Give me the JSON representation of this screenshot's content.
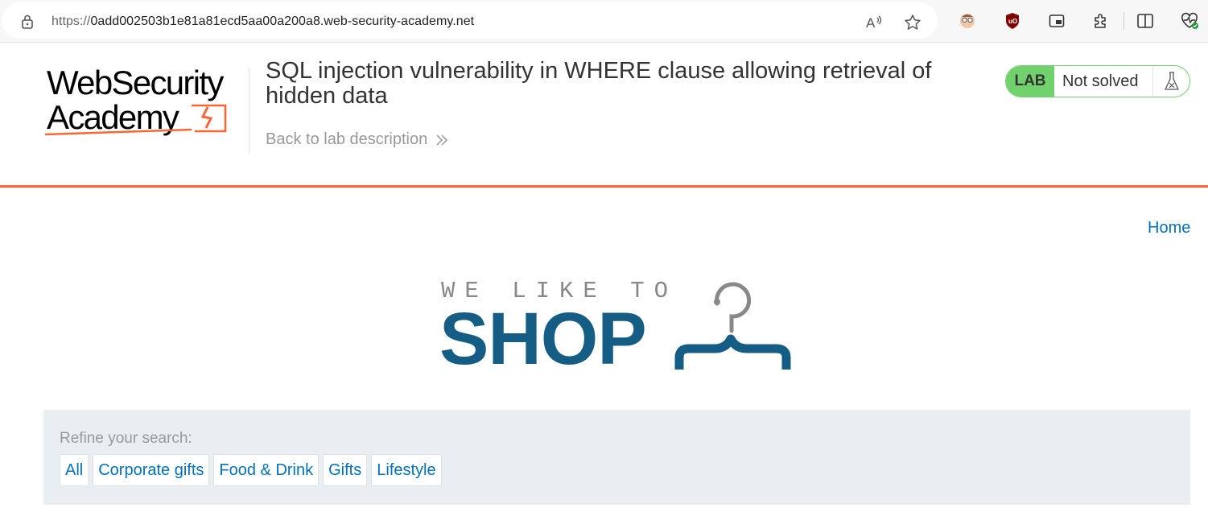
{
  "browser": {
    "url_prefix": "https://",
    "url_host": "0add002503b1e81a81ecd5aa00a200a8.web-security-academy.net",
    "icons": [
      "lock-icon",
      "read-aloud-icon",
      "favorite-star-icon",
      "extension-avatar-icon",
      "ublock-icon",
      "picture-in-picture-icon",
      "extensions-puzzle-icon",
      "split-screen-icon",
      "browser-essentials-icon"
    ]
  },
  "lab_header": {
    "logo_line1": "WebSecurity",
    "logo_line2": "Academy",
    "title": "SQL injection vulnerability in WHERE clause allowing retrieval of hidden data",
    "back_link": "Back to lab description",
    "badge": "LAB",
    "status": "Not solved",
    "accent_color": "#ff6633",
    "badge_color": "#70d16d"
  },
  "nav": {
    "home": "Home"
  },
  "shop_logo": {
    "tagline": "WE LIKE TO",
    "word": "SHOP",
    "color": "#155d84"
  },
  "filters": {
    "label": "Refine your search:",
    "items": [
      "All",
      "Corporate gifts",
      "Food & Drink",
      "Gifts",
      "Lifestyle"
    ]
  }
}
